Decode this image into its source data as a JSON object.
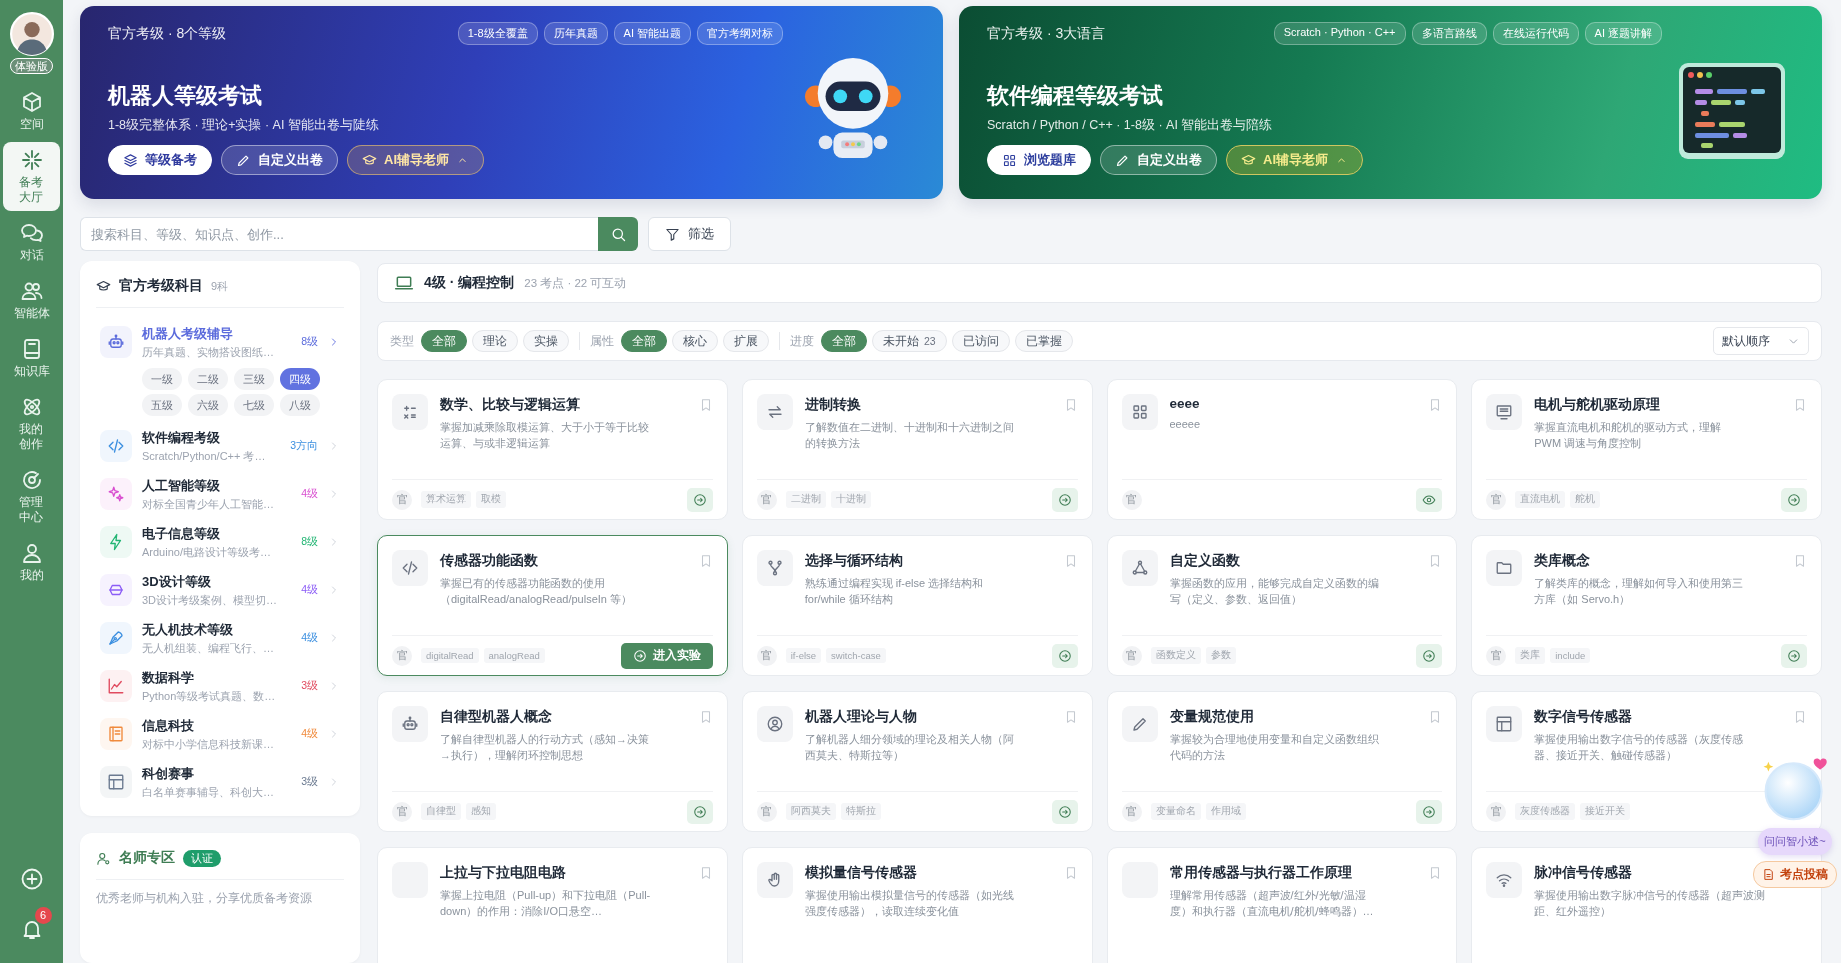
{
  "sidebar": {
    "avatar_badge": "体验版",
    "items": [
      {
        "label": "空间",
        "selected": false
      },
      {
        "label": "备考大厅",
        "selected": true
      },
      {
        "label": "对话",
        "selected": false
      },
      {
        "label": "智能体",
        "selected": false
      },
      {
        "label": "知识库",
        "selected": false
      },
      {
        "label": "我的创作",
        "selected": false
      },
      {
        "label": "管理中心",
        "selected": false
      },
      {
        "label": "我的",
        "selected": false
      }
    ],
    "notifications": "6"
  },
  "banners": [
    {
      "kind": "robot",
      "eyebrow": "官方考级 · 8个等级",
      "tags": [
        "1-8级全覆盖",
        "历年真题",
        "AI 智能出题",
        "官方考纲对标"
      ],
      "title": "机器人等级考试",
      "subtitle": "1-8级完整体系 · 理论+实操 · AI 智能出卷与陡练",
      "buttons": [
        {
          "label": "等级备考",
          "kind": "primary"
        },
        {
          "label": "自定义出卷",
          "kind": "ghost"
        },
        {
          "label": "AI辅导老师",
          "kind": "ai"
        }
      ]
    },
    {
      "kind": "code",
      "eyebrow": "官方考级 · 3大语言",
      "tags": [
        "Scratch · Python · C++",
        "多语言路线",
        "在线运行代码",
        "AI 逐题讲解"
      ],
      "title": "软件编程等级考试",
      "subtitle": "Scratch / Python / C++ · 1-8级 · AI 智能出卷与陪练",
      "buttons": [
        {
          "label": "浏览题库",
          "kind": "primary"
        },
        {
          "label": "自定义出卷",
          "kind": "ghost"
        },
        {
          "label": "AI辅导老师",
          "kind": "ai"
        }
      ]
    }
  ],
  "search": {
    "placeholder": "搜索科目、等级、知识点、创作...",
    "filter_button": "筛选"
  },
  "subjects_panel": {
    "title": "官方考级科目",
    "count": "9科",
    "subjects": [
      {
        "name": "机器人考级辅导",
        "description": "历年真题、实物搭设图纸…",
        "badge": "8级",
        "color": "#5b6bdc",
        "selected": true,
        "levels": [
          {
            "label": "一级",
            "selected": false
          },
          {
            "label": "二级",
            "selected": false
          },
          {
            "label": "三级",
            "selected": false
          },
          {
            "label": "四级",
            "selected": true
          },
          {
            "label": "五级",
            "selected": false
          },
          {
            "label": "六级",
            "selected": false
          },
          {
            "label": "七级",
            "selected": false
          },
          {
            "label": "八级",
            "selected": false
          }
        ]
      },
      {
        "name": "软件编程考级",
        "description": "Scratch/Python/C++ 考…",
        "badge": "3方向",
        "color": "#3b8fe0",
        "selected": false
      },
      {
        "name": "人工智能等级",
        "description": "对标全国青少年人工智能…",
        "badge": "4级",
        "color": "#d94fd0",
        "selected": false
      },
      {
        "name": "电子信息等级",
        "description": "Arduino/电路设计等级考…",
        "badge": "8级",
        "color": "#22b573",
        "selected": false
      },
      {
        "name": "3D设计等级",
        "description": "3D设计考级案例、模型切…",
        "badge": "4级",
        "color": "#8b5cf6",
        "selected": false
      },
      {
        "name": "无人机技术等级",
        "description": "无人机组装、编程飞行、…",
        "badge": "4级",
        "color": "#3b8fe0",
        "selected": false
      },
      {
        "name": "数据科学",
        "description": "Python等级考试真题、数…",
        "badge": "3级",
        "color": "#e04a5f",
        "selected": false
      },
      {
        "name": "信息科技",
        "description": "对标中小学信息科技新课…",
        "badge": "4级",
        "color": "#f08a3c",
        "selected": false
      },
      {
        "name": "科创赛事",
        "description": "白名单赛事辅导、科创大…",
        "badge": "3级",
        "color": "#6b7a90",
        "selected": false
      }
    ]
  },
  "teachers_panel": {
    "title": "名师专区",
    "badge": "认证",
    "description": "优秀老师与机构入驻，分享优质备考资源"
  },
  "topic_header": {
    "title": "4级 · 编程控制",
    "meta": "23 考点 · 22 可互动"
  },
  "filters": [
    {
      "label": "类型",
      "options": [
        {
          "label": "全部",
          "selected": true
        },
        {
          "label": "理论",
          "selected": false
        },
        {
          "label": "实操",
          "selected": false
        }
      ]
    },
    {
      "label": "属性",
      "options": [
        {
          "label": "全部",
          "selected": true
        },
        {
          "label": "核心",
          "selected": false
        },
        {
          "label": "扩展",
          "selected": false
        }
      ]
    },
    {
      "label": "进度",
      "options": [
        {
          "label": "全部",
          "selected": true
        },
        {
          "label": "未开始",
          "count": "23",
          "selected": false
        },
        {
          "label": "已访问",
          "selected": false
        },
        {
          "label": "已掌握",
          "selected": false
        }
      ]
    }
  ],
  "sort": "默认顺序",
  "cards": [
    {
      "title": "数学、比较与逻辑运算",
      "description": "掌握加减乘除取模运算、大于小于等于比较运算、与或非逻辑运算",
      "badge": "官",
      "tags": [
        "算术运算",
        "取模"
      ],
      "action": {
        "kind": "go"
      },
      "selected": false
    },
    {
      "title": "进制转换",
      "description": "了解数值在二进制、十进制和十六进制之间的转换方法",
      "badge": "官",
      "tags": [
        "二进制",
        "十进制"
      ],
      "action": {
        "kind": "go"
      },
      "selected": false
    },
    {
      "title": "eeee",
      "description": "eeeee",
      "badge": "官",
      "action": {
        "kind": "view"
      },
      "selected": false
    },
    {
      "title": "电机与舵机驱动原理",
      "description": "掌握直流电机和舵机的驱动方式，理解 PWM 调速与角度控制",
      "badge": "官",
      "tags": [
        "直流电机",
        "舵机"
      ],
      "action": {
        "kind": "go"
      },
      "selected": false
    },
    {
      "title": "传感器功能函数",
      "description": "掌握已有的传感器功能函数的使用（digitalRead/analogRead/pulseIn 等）",
      "badge": "官",
      "tags": [
        "digitalRead",
        "analogRead"
      ],
      "action": {
        "kind": "enter",
        "label": "进入实验"
      },
      "selected": true
    },
    {
      "title": "选择与循环结构",
      "description": "熟练通过编程实现 if-else 选择结构和 for/while 循环结构",
      "badge": "官",
      "tags": [
        "if-else",
        "switch-case"
      ],
      "action": {
        "kind": "go"
      },
      "selected": false
    },
    {
      "title": "自定义函数",
      "description": "掌握函数的应用，能够完成自定义函数的编写（定义、参数、返回值）",
      "badge": "官",
      "tags": [
        "函数定义",
        "参数"
      ],
      "action": {
        "kind": "go"
      },
      "selected": false
    },
    {
      "title": "类库概念",
      "description": "了解类库的概念，理解如何导入和使用第三方库（如 Servo.h）",
      "badge": "官",
      "tags": [
        "类库",
        "include"
      ],
      "action": {
        "kind": "go"
      },
      "selected": false
    },
    {
      "title": "自律型机器人概念",
      "description": "了解自律型机器人的行动方式（感知→决策→执行），理解闭环控制思想",
      "badge": "官",
      "tags": [
        "自律型",
        "感知"
      ],
      "action": {
        "kind": "go"
      },
      "selected": false
    },
    {
      "title": "机器人理论与人物",
      "description": "了解机器人细分领域的理论及相关人物（阿西莫夫、特斯拉等）",
      "badge": "官",
      "tags": [
        "阿西莫夫",
        "特斯拉"
      ],
      "action": {
        "kind": "go"
      },
      "selected": false
    },
    {
      "title": "变量规范使用",
      "description": "掌握较为合理地使用变量和自定义函数组织代码的方法",
      "badge": "官",
      "tags": [
        "变量命名",
        "作用域"
      ],
      "action": {
        "kind": "go"
      },
      "selected": false
    },
    {
      "title": "数字信号传感器",
      "description": "掌握使用输出数字信号的传感器（灰度传感器、接近开关、触碰传感器）",
      "badge": "官",
      "tags": [
        "灰度传感器",
        "接近开关"
      ],
      "selected": false
    },
    {
      "title": "上拉与下拉电阻电路",
      "description": "掌握上拉电阻（Pull-up）和下拉电阻（Pull-down）的作用：消除I/O口悬空…",
      "selected": false
    },
    {
      "title": "模拟量信号传感器",
      "description": "掌握使用输出模拟量信号的传感器（如光线强度传感器），读取连续变化值",
      "selected": false
    },
    {
      "title": "常用传感器与执行器工作原理",
      "description": "理解常用传感器（超声波/红外/光敏/温湿度）和执行器（直流电机/舵机/蜂鸣器）…",
      "selected": false
    },
    {
      "title": "脉冲信号传感器",
      "description": "掌握使用输出数字脉冲信号的传感器（超声波测距、红外遥控）",
      "selected": false
    }
  ],
  "assistant": {
    "prompt": "问问智小述~",
    "button": "考点投稿"
  }
}
